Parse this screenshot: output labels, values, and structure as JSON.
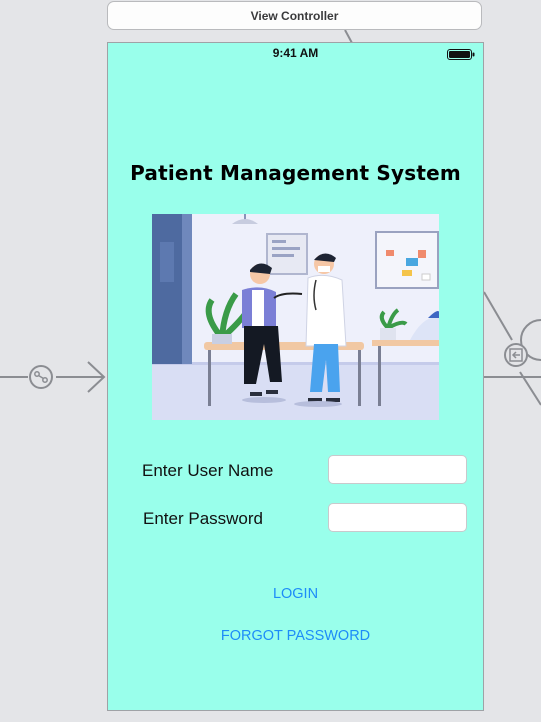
{
  "storyboard": {
    "controller_title": "View Controller"
  },
  "status_bar": {
    "time": "9:41 AM"
  },
  "screen": {
    "title": "Patient Management System",
    "illustration_icon": "doctor-patient-illustration",
    "username_label": "Enter User Name",
    "username_value": "",
    "password_label": "Enter Password",
    "password_value": "",
    "login_label": "LOGIN",
    "forgot_label": "FORGOT PASSWORD"
  },
  "colors": {
    "background": "#99ffeb",
    "link": "#1d8cf8"
  }
}
